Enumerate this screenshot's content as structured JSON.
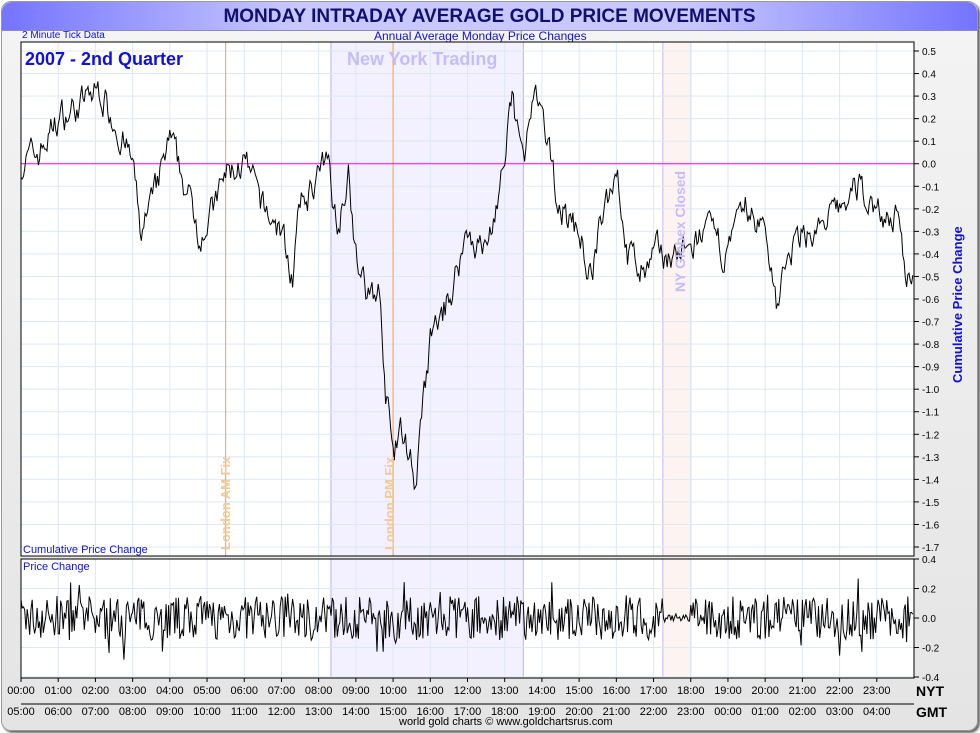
{
  "header": {
    "title": "MONDAY INTRADAY AVERAGE GOLD PRICE MOVEMENTS",
    "tick_note": "2 Minute Tick Data",
    "subtitle": "Annual Average Monday Price Changes"
  },
  "footer": {
    "credit": "world gold charts © www.goldchartsrus.com"
  },
  "chart_data": [
    {
      "type": "line",
      "title": "2007 - 2nd Quarter",
      "panel_label": "Cumulative Price Change",
      "ylabel": "Cumulative Price Change",
      "ylim": [
        -1.75,
        0.55
      ],
      "yticks": [
        "0.5",
        "0.4",
        "0.3",
        "0.2",
        "0.1",
        "0.0",
        "-0.1",
        "-0.2",
        "-0.3",
        "-0.4",
        "-0.5",
        "-0.6",
        "-0.7",
        "-0.8",
        "-0.9",
        "-1.0",
        "-1.1",
        "-1.2",
        "-1.3",
        "-1.4",
        "-1.5",
        "-1.6",
        "-1.7"
      ],
      "xlim_hours_nyt": [
        0,
        24
      ],
      "interval_minutes": 2,
      "keypoints": [
        [
          0,
          0
        ],
        [
          0.5,
          0.05
        ],
        [
          1,
          0.2
        ],
        [
          1.5,
          0.25
        ],
        [
          2.1,
          0.33
        ],
        [
          2.5,
          0.2
        ],
        [
          3,
          0
        ],
        [
          3.2,
          -0.3
        ],
        [
          3.5,
          -0.2
        ],
        [
          4,
          0.1
        ],
        [
          4.3,
          -0.05
        ],
        [
          4.8,
          -0.3
        ],
        [
          5.2,
          -0.2
        ],
        [
          5.5,
          -0.05
        ],
        [
          6,
          0
        ],
        [
          6.5,
          -0.2
        ],
        [
          7,
          -0.3
        ],
        [
          7.3,
          -0.5
        ],
        [
          7.5,
          -0.2
        ],
        [
          8,
          -0.05
        ],
        [
          8.3,
          0
        ],
        [
          8.5,
          -0.3
        ],
        [
          8.8,
          0
        ],
        [
          9,
          -0.4
        ],
        [
          9.3,
          -0.6
        ],
        [
          9.6,
          -0.55
        ],
        [
          9.8,
          -1.0
        ],
        [
          10,
          -1.3
        ],
        [
          10.2,
          -1.2
        ],
        [
          10.5,
          -1.3
        ],
        [
          10.6,
          -1.45
        ],
        [
          10.8,
          -1.1
        ],
        [
          11,
          -0.8
        ],
        [
          11.5,
          -0.6
        ],
        [
          12,
          -0.3
        ],
        [
          12.5,
          -0.4
        ],
        [
          13,
          0
        ],
        [
          13.2,
          0.28
        ],
        [
          13.5,
          0
        ],
        [
          13.8,
          0.3
        ],
        [
          14.1,
          0.1
        ],
        [
          14.5,
          -0.2
        ],
        [
          15,
          -0.3
        ],
        [
          15.3,
          -0.5
        ],
        [
          15.7,
          -0.2
        ],
        [
          16,
          0
        ],
        [
          16.3,
          -0.4
        ],
        [
          16.8,
          -0.5
        ],
        [
          17,
          -0.4
        ],
        [
          17.5,
          -0.4
        ],
        [
          18,
          -0.4
        ],
        [
          18.3,
          -0.3
        ],
        [
          19,
          -0.4
        ],
        [
          19.5,
          -0.2
        ],
        [
          20,
          -0.3
        ],
        [
          20.3,
          -0.6
        ],
        [
          20.7,
          -0.4
        ],
        [
          21,
          -0.3
        ],
        [
          21.5,
          -0.3
        ],
        [
          22,
          -0.2
        ],
        [
          22.5,
          -0.1
        ],
        [
          23,
          -0.2
        ],
        [
          23.5,
          -0.25
        ],
        [
          23.8,
          -0.5
        ],
        [
          24,
          -0.45
        ]
      ]
    },
    {
      "type": "line",
      "panel_label": "Price Change",
      "ylim": [
        -0.4,
        0.4
      ],
      "yticks": [
        "0.4",
        "0.2",
        "0.0",
        "-0.2",
        "-0.4"
      ]
    }
  ],
  "annotations": {
    "london_am_fix": {
      "label": "London AM Fix",
      "time_nyt": 5.5,
      "color": "#f5a040"
    },
    "london_pm_fix": {
      "label": "London PM Fix",
      "time_nyt": 10.0,
      "color": "#f5a040"
    },
    "ny_trading": {
      "label": "New York Trading",
      "start_nyt": 8.33,
      "end_nyt": 13.5,
      "color": "#c0b8ff"
    },
    "globex_closed": {
      "label": "NY Globex Closed",
      "start_nyt": 17.25,
      "end_nyt": 18.0,
      "color": "#f0c0c0"
    }
  },
  "x_axis": {
    "nyt_label": "NYT",
    "gmt_label": "GMT",
    "nyt": [
      "00:00",
      "01:00",
      "02:00",
      "03:00",
      "04:00",
      "05:00",
      "06:00",
      "07:00",
      "08:00",
      "09:00",
      "10:00",
      "11:00",
      "12:00",
      "13:00",
      "14:00",
      "15:00",
      "16:00",
      "17:00",
      "18:00",
      "19:00",
      "20:00",
      "21:00",
      "22:00",
      "23:00"
    ],
    "gmt": [
      "05:00",
      "06:00",
      "07:00",
      "08:00",
      "09:00",
      "10:00",
      "11:00",
      "12:00",
      "13:00",
      "14:00",
      "15:00",
      "16:00",
      "17:00",
      "18:00",
      "19:00",
      "20:00",
      "21:00",
      "22:00",
      "23:00",
      "00:00",
      "01:00",
      "02:00",
      "03:00",
      "04:00"
    ]
  }
}
